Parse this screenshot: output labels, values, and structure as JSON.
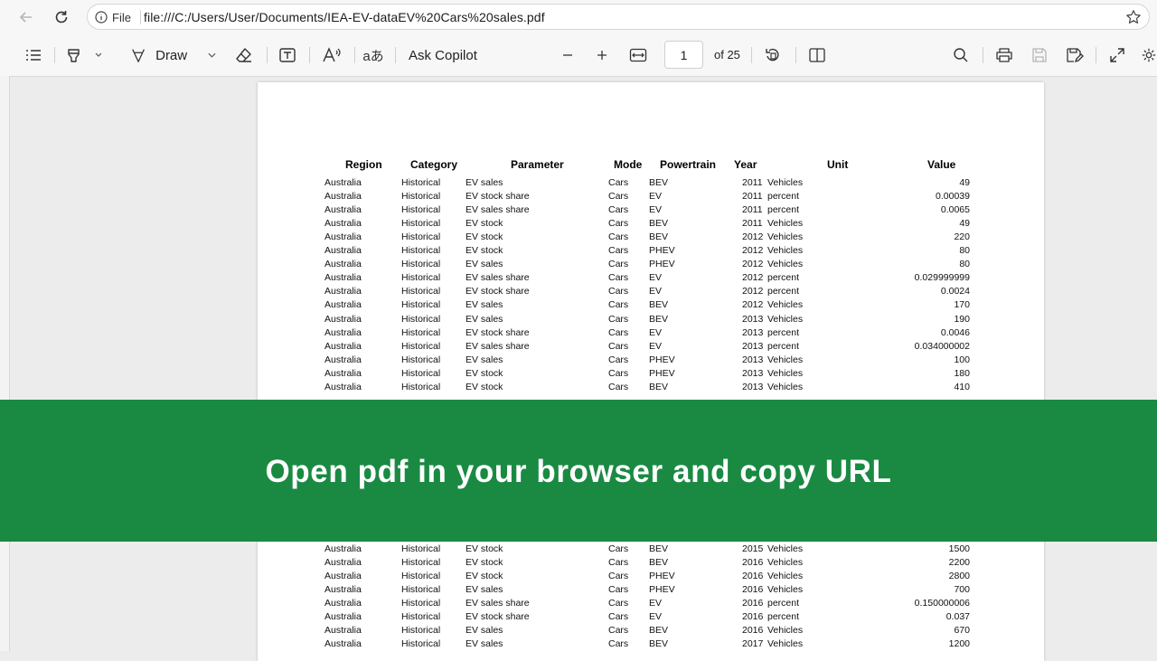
{
  "browser": {
    "url_scheme_label": "File",
    "url": "file:///C:/Users/User/Documents/IEA-EV-dataEV%20Cars%20sales.pdf"
  },
  "toolbar": {
    "draw_label": "Draw",
    "copilot_label": "Ask Copilot",
    "current_page": "1",
    "page_count": "of 25"
  },
  "table": {
    "headers": [
      "Region",
      "Category",
      "Parameter",
      "Mode",
      "Powertrain",
      "Year",
      "Unit",
      "Value"
    ],
    "rows_top": [
      [
        "Australia",
        "Historical",
        "EV sales",
        "Cars",
        "BEV",
        "2011",
        "Vehicles",
        "49"
      ],
      [
        "Australia",
        "Historical",
        "EV stock share",
        "Cars",
        "EV",
        "2011",
        "percent",
        "0.00039"
      ],
      [
        "Australia",
        "Historical",
        "EV sales share",
        "Cars",
        "EV",
        "2011",
        "percent",
        "0.0065"
      ],
      [
        "Australia",
        "Historical",
        "EV stock",
        "Cars",
        "BEV",
        "2011",
        "Vehicles",
        "49"
      ],
      [
        "Australia",
        "Historical",
        "EV stock",
        "Cars",
        "BEV",
        "2012",
        "Vehicles",
        "220"
      ],
      [
        "Australia",
        "Historical",
        "EV stock",
        "Cars",
        "PHEV",
        "2012",
        "Vehicles",
        "80"
      ],
      [
        "Australia",
        "Historical",
        "EV sales",
        "Cars",
        "PHEV",
        "2012",
        "Vehicles",
        "80"
      ],
      [
        "Australia",
        "Historical",
        "EV sales share",
        "Cars",
        "EV",
        "2012",
        "percent",
        "0.029999999"
      ],
      [
        "Australia",
        "Historical",
        "EV stock share",
        "Cars",
        "EV",
        "2012",
        "percent",
        "0.0024"
      ],
      [
        "Australia",
        "Historical",
        "EV sales",
        "Cars",
        "BEV",
        "2012",
        "Vehicles",
        "170"
      ],
      [
        "Australia",
        "Historical",
        "EV sales",
        "Cars",
        "BEV",
        "2013",
        "Vehicles",
        "190"
      ],
      [
        "Australia",
        "Historical",
        "EV stock share",
        "Cars",
        "EV",
        "2013",
        "percent",
        "0.0046"
      ],
      [
        "Australia",
        "Historical",
        "EV sales share",
        "Cars",
        "EV",
        "2013",
        "percent",
        "0.034000002"
      ],
      [
        "Australia",
        "Historical",
        "EV sales",
        "Cars",
        "PHEV",
        "2013",
        "Vehicles",
        "100"
      ],
      [
        "Australia",
        "Historical",
        "EV stock",
        "Cars",
        "PHEV",
        "2013",
        "Vehicles",
        "180"
      ],
      [
        "Australia",
        "Historical",
        "EV stock",
        "Cars",
        "BEV",
        "2013",
        "Vehicles",
        "410"
      ]
    ],
    "rows_bottom": [
      [
        "Australia",
        "Historical",
        "EV stock",
        "Cars",
        "BEV",
        "2015",
        "Vehicles",
        "1500"
      ],
      [
        "Australia",
        "Historical",
        "EV stock",
        "Cars",
        "BEV",
        "2016",
        "Vehicles",
        "2200"
      ],
      [
        "Australia",
        "Historical",
        "EV stock",
        "Cars",
        "PHEV",
        "2016",
        "Vehicles",
        "2800"
      ],
      [
        "Australia",
        "Historical",
        "EV sales",
        "Cars",
        "PHEV",
        "2016",
        "Vehicles",
        "700"
      ],
      [
        "Australia",
        "Historical",
        "EV sales share",
        "Cars",
        "EV",
        "2016",
        "percent",
        "0.150000006"
      ],
      [
        "Australia",
        "Historical",
        "EV stock share",
        "Cars",
        "EV",
        "2016",
        "percent",
        "0.037"
      ],
      [
        "Australia",
        "Historical",
        "EV sales",
        "Cars",
        "BEV",
        "2016",
        "Vehicles",
        "670"
      ],
      [
        "Australia",
        "Historical",
        "EV sales",
        "Cars",
        "BEV",
        "2017",
        "Vehicles",
        "1200"
      ]
    ]
  },
  "banner": {
    "text": "Open pdf in your browser and copy URL",
    "color": "#1a8a43"
  }
}
